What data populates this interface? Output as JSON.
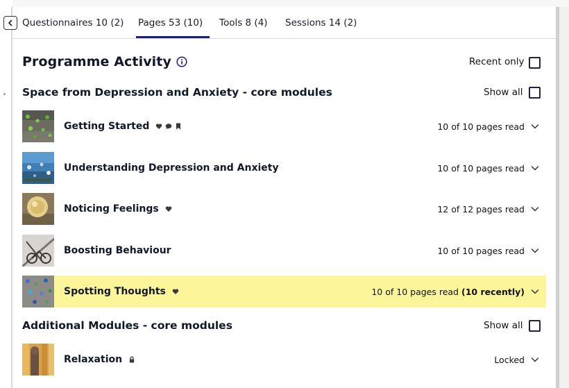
{
  "tabs": [
    {
      "label": "Questionnaires 10 (2)",
      "active": false
    },
    {
      "label": "Pages 53 (10)",
      "active": true
    },
    {
      "label": "Tools 8 (4)",
      "active": false
    },
    {
      "label": "Sessions 14 (2)",
      "active": false
    }
  ],
  "page": {
    "title": "Programme Activity",
    "recent_only_label": "Recent only"
  },
  "sections": [
    {
      "title": "Space from Depression and Anxiety - core modules",
      "show_all_label": "Show all",
      "modules": [
        {
          "name": "Getting Started",
          "icons": [
            "heart-icon",
            "comment-icon",
            "bookmark-icon"
          ],
          "status": "10 of 10 pages read",
          "recent": ""
        },
        {
          "name": "Understanding Depression and Anxiety",
          "icons": [],
          "status": "10 of 10 pages read",
          "recent": ""
        },
        {
          "name": "Noticing Feelings",
          "icons": [
            "heart-icon"
          ],
          "status": "12 of 12 pages read",
          "recent": ""
        },
        {
          "name": "Boosting Behaviour",
          "icons": [],
          "status": "10 of 10 pages read",
          "recent": ""
        },
        {
          "name": "Spotting Thoughts",
          "icons": [
            "heart-icon"
          ],
          "status": "10 of 10 pages read",
          "recent": "(10 recently)",
          "highlighted": true
        }
      ]
    },
    {
      "title": "Additional Modules - core modules",
      "show_all_label": "Show all",
      "modules": [
        {
          "name": "Relaxation",
          "icons": [
            "lock-icon"
          ],
          "status": "Locked",
          "recent": ""
        }
      ]
    }
  ],
  "colors": {
    "accent": "#1f1f7a",
    "highlight": "#fdf59a",
    "text": "#111827"
  }
}
